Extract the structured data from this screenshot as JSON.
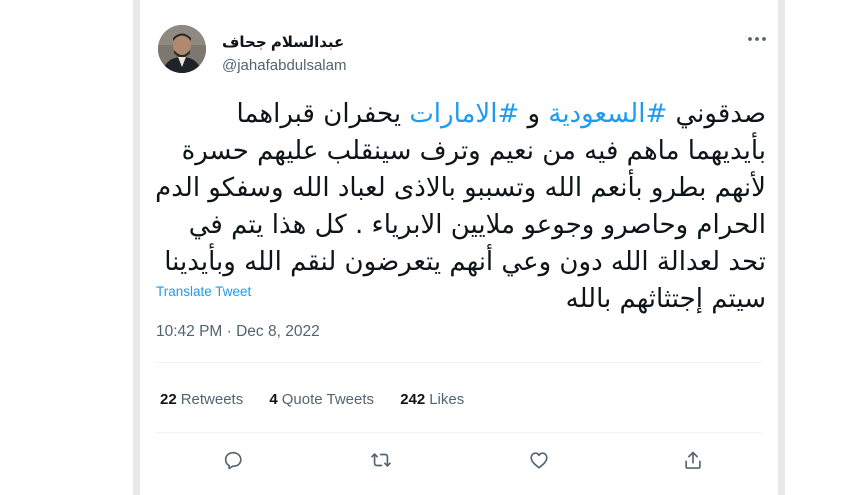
{
  "author": {
    "display_name": "عبدالسلام جحاف",
    "handle": "@jahafabdulsalam"
  },
  "tweet": {
    "parts": {
      "p1": "صدقوني ",
      "hashtag1": "#السعودية",
      "p2": " و ",
      "hashtag2": "#الامارات",
      "p3": " يحفران قبراهما بأيديهما ماهم فيه من نعيم وترف سينقلب عليهم حسرة لأنهم بطرو بأنعم الله وتسببو بالاذى لعباد الله وسفكو الدم الحرام وحاصرو وجوعو ملايين الابرياء . كل هذا يتم في تحد لعدالة الله دون وعي أنهم يتعرضون لنقم الله وبأيدينا سيتم إجتثاثهم بالله"
    },
    "translate_label": "Translate Tweet",
    "timestamp": "10:42 PM · Dec 8, 2022"
  },
  "stats": {
    "retweets_count": "22",
    "retweets_label": "Retweets",
    "quotes_count": "4",
    "quotes_label": "Quote Tweets",
    "likes_count": "242",
    "likes_label": "Likes"
  },
  "icons": {
    "more": "more-horizontal-icon",
    "reply": "reply-icon",
    "retweet": "retweet-icon",
    "like": "heart-icon",
    "share": "share-icon"
  },
  "colors": {
    "link": "#1d9bf0",
    "text": "#0f1419",
    "secondary": "#536471"
  }
}
